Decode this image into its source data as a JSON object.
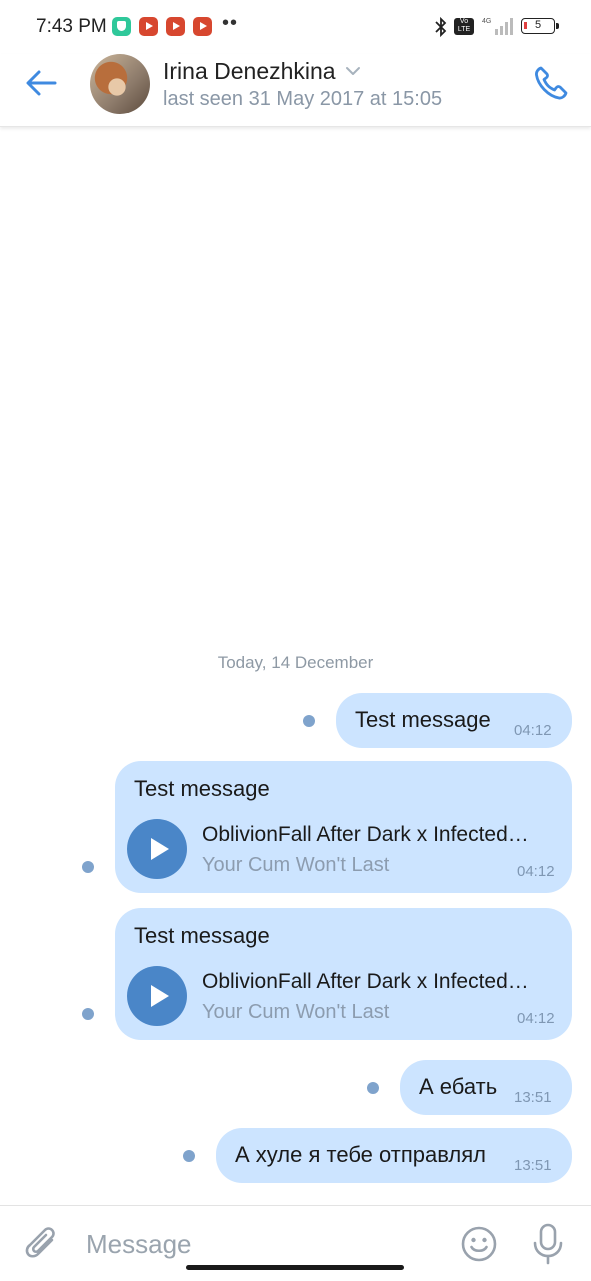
{
  "status_bar": {
    "time": "7:43 PM",
    "volte_label": "Vo LTE",
    "network_label": "4G",
    "battery_level": "5",
    "battery_color": "#e04040"
  },
  "header": {
    "contact_name": "Irina Denezhkina",
    "last_seen": "last seen 31 May 2017 at 15:05"
  },
  "chat": {
    "date_separator": "Today, 14 December",
    "messages": [
      {
        "text": "Test message",
        "time": "04:12"
      },
      {
        "text": "Test message",
        "time": "04:12",
        "track_title": "OblivionFall After Dark x Infected…",
        "track_artist": "Your Cum Won't Last"
      },
      {
        "text": "Test message",
        "time": "04:12",
        "track_title": "OblivionFall After Dark x Infected…",
        "track_artist": "Your Cum Won't Last"
      },
      {
        "text": "А ебать",
        "time": "13:51"
      },
      {
        "text": "А хуле я тебе отправлял",
        "time": "13:51"
      }
    ]
  },
  "composer": {
    "placeholder": "Message"
  },
  "colors": {
    "accent": "#3f8ae0",
    "bubble": "#cce4ff",
    "play_button": "#4a86c8",
    "unread_dot": "#7fa3cc"
  }
}
